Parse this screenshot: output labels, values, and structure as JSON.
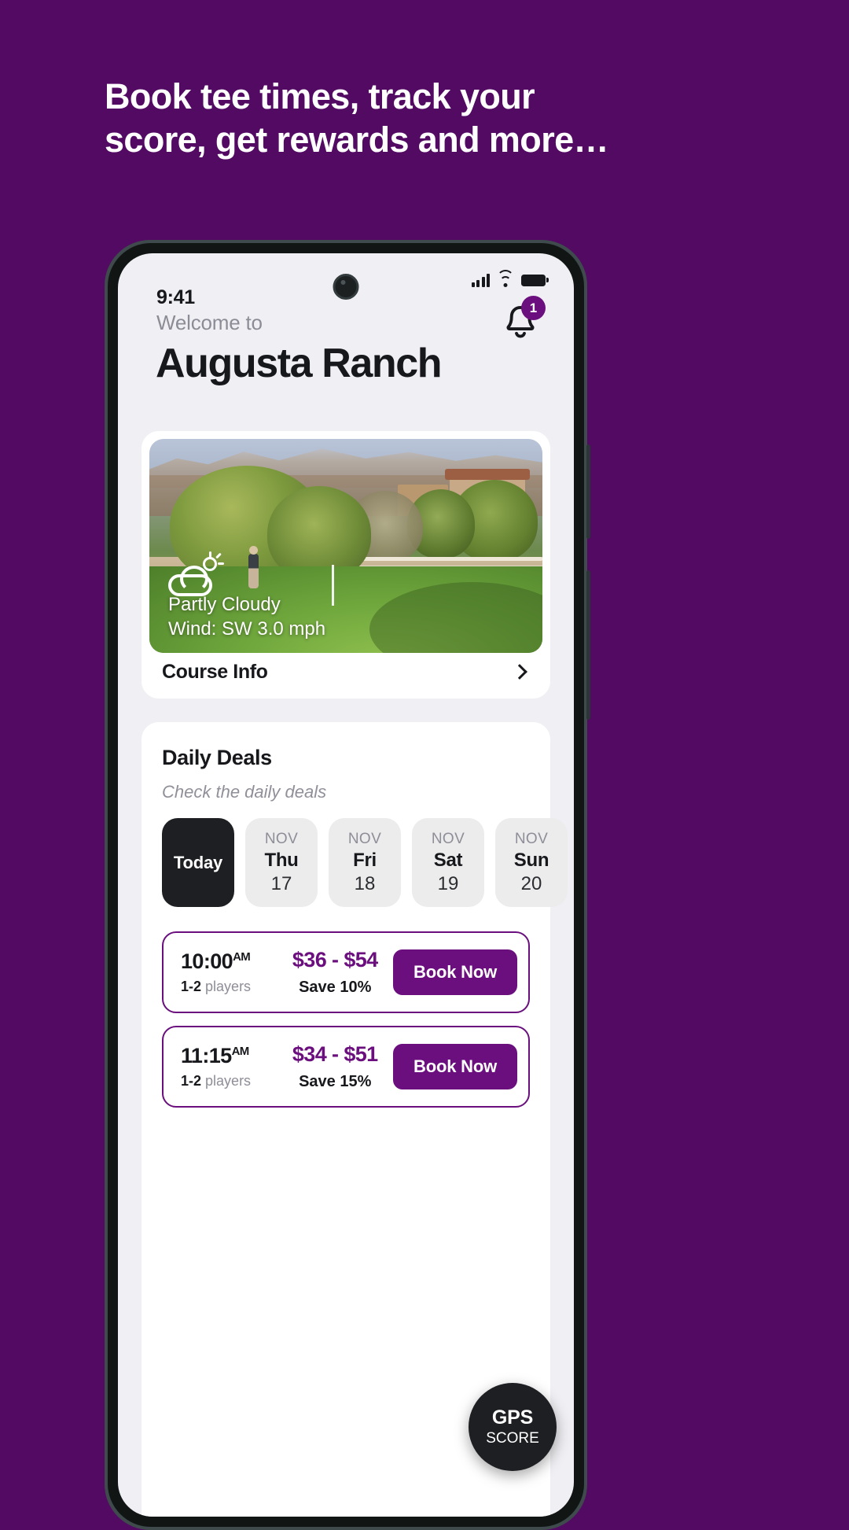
{
  "marketing": {
    "headline_line1": "Book tee times, track your",
    "headline_line2": "score, get rewards and more…",
    "background_color": "#520A63"
  },
  "phone": {
    "statusbar": {
      "signal_icon": "cellular-signal-icon",
      "wifi_icon": "wifi-icon",
      "battery_icon": "battery-full-icon"
    },
    "header": {
      "clock": "9:41",
      "welcome_label": "Welcome to",
      "course_name": "Augusta Ranch",
      "notification_icon": "bell-icon",
      "notification_count": "1",
      "badge_color": "#6b0f7e"
    },
    "hero": {
      "weather_icon": "partly-cloudy-icon",
      "condition": "Partly Cloudy",
      "wind": "Wind: SW 3.0 mph",
      "course_info_label": "Course Info",
      "chevron_icon": "chevron-right-icon"
    },
    "deals": {
      "title": "Daily Deals",
      "subtitle": "Check the daily deals",
      "dates": [
        {
          "month": "",
          "dow": "Today",
          "day": "",
          "selected": true
        },
        {
          "month": "NOV",
          "dow": "Thu",
          "day": "17",
          "selected": false
        },
        {
          "month": "NOV",
          "dow": "Fri",
          "day": "18",
          "selected": false
        },
        {
          "month": "NOV",
          "dow": "Sat",
          "day": "19",
          "selected": false
        },
        {
          "month": "NOV",
          "dow": "Sun",
          "day": "20",
          "selected": false
        }
      ],
      "tee_times": [
        {
          "time": "10:00",
          "meridiem": "AM",
          "players": "1-2",
          "players_label": "players",
          "price": "$36 - $54",
          "save": "Save 10%",
          "book_label": "Book Now"
        },
        {
          "time": "11:15",
          "meridiem": "AM",
          "players": "1-2",
          "players_label": "players",
          "price": "$34 - $51",
          "save": "Save 15%",
          "book_label": "Book Now"
        }
      ],
      "accent_color": "#6b0f7e"
    },
    "gps_badge": {
      "main": "GPS",
      "sub": "SCORE"
    }
  }
}
